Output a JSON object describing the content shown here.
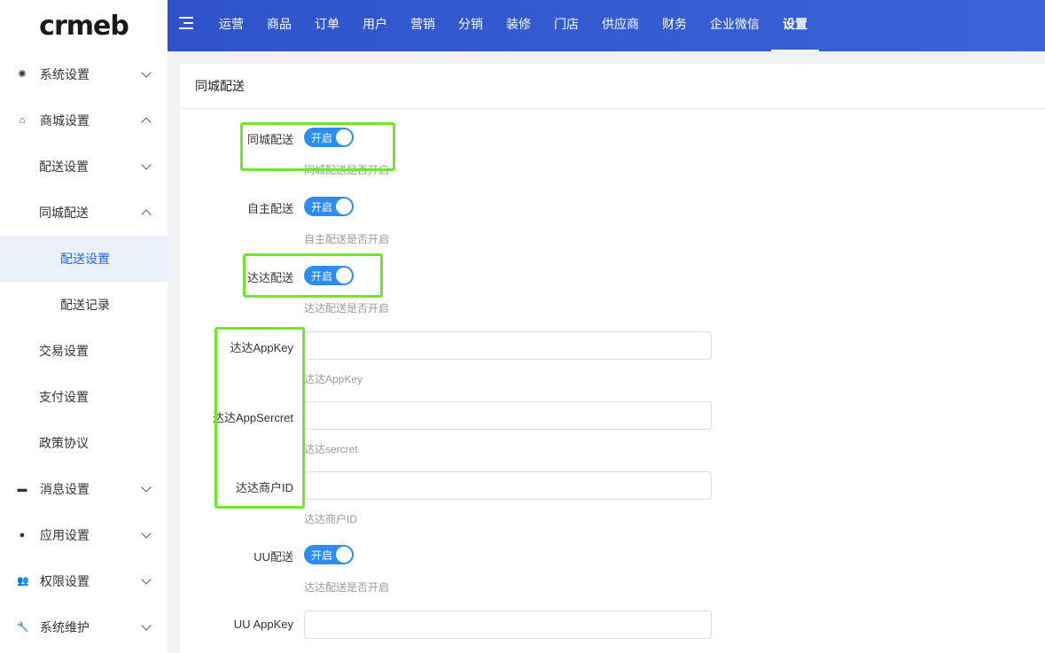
{
  "header": {
    "logo": "crmeb",
    "nav": [
      "运营",
      "商品",
      "订单",
      "用户",
      "营销",
      "分销",
      "装修",
      "门店",
      "供应商",
      "财务",
      "企业微信",
      "设置"
    ],
    "active_nav": "设置"
  },
  "sidebar": {
    "items": [
      {
        "label": "系统设置",
        "icon": "gear-icon"
      },
      {
        "label": "商城设置",
        "icon": "store-icon"
      },
      {
        "label": "配送设置"
      },
      {
        "label": "同城配送"
      },
      {
        "label": "配送设置"
      },
      {
        "label": "配送记录"
      },
      {
        "label": "交易设置"
      },
      {
        "label": "支付设置"
      },
      {
        "label": "政策协议"
      },
      {
        "label": "消息设置",
        "icon": "message-icon"
      },
      {
        "label": "应用设置",
        "icon": "app-icon"
      },
      {
        "label": "权限设置",
        "icon": "users-icon"
      },
      {
        "label": "系统维护",
        "icon": "wrench-icon"
      }
    ]
  },
  "main": {
    "title": "同城配送",
    "fields": {
      "city_delivery": {
        "label": "同城配送",
        "switch": "开启",
        "help": "同城配送是否开启"
      },
      "self_delivery": {
        "label": "自主配送",
        "switch": "开启",
        "help": "自主配送是否开启"
      },
      "dada_delivery": {
        "label": "达达配送",
        "switch": "开启",
        "help": "达达配送是否开启"
      },
      "dada_appkey": {
        "label": "达达AppKey",
        "value": "",
        "help": "达达AppKey"
      },
      "dada_appsecret": {
        "label": "达达AppSercret",
        "value": "",
        "help": "达达sercret"
      },
      "dada_merchant_id": {
        "label": "达达商户ID",
        "value": "",
        "help": "达达商户ID"
      },
      "uu_delivery": {
        "label": "UU配送",
        "switch": "开启",
        "help": "达达配送是否开启"
      },
      "uu_appkey": {
        "label": "UU AppKey",
        "value": ""
      }
    }
  },
  "colors": {
    "header": "#2d4fc8",
    "switch_on": "#2d8cf0",
    "highlight": "#6ee829",
    "active_item_bg": "#eaf1fb"
  }
}
